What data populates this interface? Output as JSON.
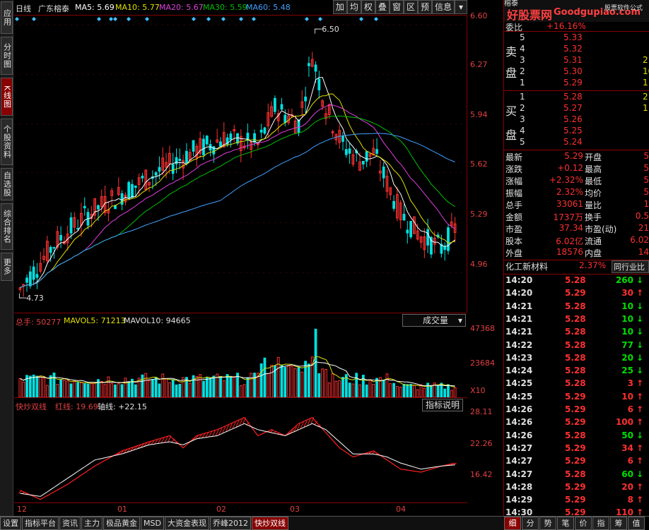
{
  "left_nav": [
    "应用",
    "分时图",
    "K线图",
    "个股资料",
    "自选股",
    "综合排名",
    "更多"
  ],
  "left_nav_active": "K线图",
  "header": {
    "period": "日线",
    "stock_name": "广东榕泰",
    "ma5": "MA5: 5.69",
    "ma10": "MA10: 5.77",
    "ma20": "MA20: 5.67",
    "ma30": "MA30: 5.59",
    "ma60": "MA60: 5.48"
  },
  "toolbar": [
    "加",
    "均",
    "权",
    "叠",
    "窗",
    "区",
    "预",
    "信息"
  ],
  "price_axis": [
    "6.60",
    "6.27",
    "5.94",
    "5.62",
    "5.29",
    "4.96"
  ],
  "annotations": {
    "high": "6.50",
    "low": "4.73"
  },
  "volume": {
    "label": "总手: 50277",
    "mavol5": "MAVOL5: 71213",
    "mavol10": "MAVOL10: 94665",
    "dropdown": "成交量",
    "ticks": [
      "47368",
      "23684"
    ],
    "unit": "X10"
  },
  "indicator": {
    "name": "快炒双线",
    "red_line": "红线: 19.69",
    "axis_line": "轴线: +22.15",
    "button": "指标说明",
    "ticks": [
      "28.11",
      "22.26",
      "16.42"
    ]
  },
  "x_axis": [
    "12",
    "01",
    "02",
    "03",
    "04"
  ],
  "bottom_tabs": [
    "设置",
    "指标平台",
    "资讯",
    "主力",
    "极品黄金",
    "MSD",
    "大资金表现",
    "乔峰2012",
    "快炒双线"
  ],
  "bottom_tabs_active": "快炒双线",
  "watermark": {
    "site": "好股票网",
    "url": "Goodgupiao.com",
    "tagline": "股票软件公式"
  },
  "quote": {
    "title_partial": "榕泰",
    "weibi_label": "委比",
    "weibi_value": "+16.16%",
    "sell_label": [
      "卖",
      "盘"
    ],
    "buy_label": [
      "买",
      "盘"
    ],
    "sell": [
      {
        "level": "5",
        "price": "5.33",
        "vol": ""
      },
      {
        "level": "4",
        "price": "5.32",
        "vol": ""
      },
      {
        "level": "3",
        "price": "5.31",
        "vol": "2"
      },
      {
        "level": "2",
        "price": "5.30",
        "vol": "10"
      },
      {
        "level": "1",
        "price": "5.29",
        "vol": "1"
      }
    ],
    "buy": [
      {
        "level": "1",
        "price": "5.28",
        "vol": "21"
      },
      {
        "level": "2",
        "price": "5.27",
        "vol": "1"
      },
      {
        "level": "3",
        "price": "5.26",
        "vol": ""
      },
      {
        "level": "4",
        "price": "5.25",
        "vol": ""
      },
      {
        "level": "5",
        "price": "5.24",
        "vol": ""
      }
    ],
    "stats": [
      {
        "l1": "最新",
        "v1": "5.29",
        "l2": "开盘",
        "v2": "5"
      },
      {
        "l1": "涨跌",
        "v1": "+0.12",
        "l2": "最高",
        "v2": "5"
      },
      {
        "l1": "涨幅",
        "v1": "+2.32%",
        "l2": "最低",
        "v2": "5"
      },
      {
        "l1": "振幅",
        "v1": "2.32%",
        "l2": "均价",
        "v2": "5"
      },
      {
        "l1": "总手",
        "v1": "33061",
        "l2": "量比",
        "v2": "1"
      },
      {
        "l1": "金额",
        "v1": "1737万",
        "l2": "换手",
        "v2": "0.5"
      },
      {
        "l1": "市盈",
        "v1": "37.34",
        "l2": "市盈(动)",
        "v2": "21"
      },
      {
        "l1": "股本",
        "v1": "6.02亿",
        "l2": "流通",
        "v2": "6.02"
      },
      {
        "l1": "外盘",
        "v1": "18576",
        "l2": "内盘",
        "v2": "14"
      }
    ],
    "sector": "化工新材料",
    "sector_change": "2.37%",
    "sector_button": "同行业比",
    "ticks": [
      {
        "time": "14:20",
        "price": "5.28",
        "vol": "260",
        "dir": "down"
      },
      {
        "time": "14:20",
        "price": "5.29",
        "vol": "30",
        "dir": "up"
      },
      {
        "time": "14:21",
        "price": "5.28",
        "vol": "10",
        "dir": "down"
      },
      {
        "time": "14:21",
        "price": "5.28",
        "vol": "10",
        "dir": "down"
      },
      {
        "time": "14:21",
        "price": "5.28",
        "vol": "10",
        "dir": "down"
      },
      {
        "time": "14:22",
        "price": "5.28",
        "vol": "77",
        "dir": "down"
      },
      {
        "time": "14:23",
        "price": "5.28",
        "vol": "20",
        "dir": "down"
      },
      {
        "time": "14:24",
        "price": "5.28",
        "vol": "25",
        "dir": "down"
      },
      {
        "time": "14:25",
        "price": "5.28",
        "vol": "3",
        "dir": "up"
      },
      {
        "time": "14:25",
        "price": "5.29",
        "vol": "10",
        "dir": "up"
      },
      {
        "time": "14:26",
        "price": "5.29",
        "vol": "6",
        "dir": "up"
      },
      {
        "time": "14:26",
        "price": "5.29",
        "vol": "100",
        "dir": "up"
      },
      {
        "time": "14:26",
        "price": "5.28",
        "vol": "50",
        "dir": "down"
      },
      {
        "time": "14:27",
        "price": "5.29",
        "vol": "34",
        "dir": "up"
      },
      {
        "time": "14:27",
        "price": "5.29",
        "vol": "6",
        "dir": "up"
      },
      {
        "time": "14:27",
        "price": "5.28",
        "vol": "60",
        "dir": "down"
      },
      {
        "time": "14:28",
        "price": "5.29",
        "vol": "20",
        "dir": "up"
      },
      {
        "time": "14:29",
        "price": "5.29",
        "vol": "8",
        "dir": "up"
      },
      {
        "time": "14:30",
        "price": "5.29",
        "vol": "110",
        "dir": "up"
      }
    ],
    "bottom_tabs": [
      "细",
      "分",
      "势",
      "笔",
      "价",
      "指",
      "筹",
      "值"
    ]
  },
  "colors": {
    "up": "#ff3030",
    "down": "#00e0e0",
    "ma5": "#ffffff",
    "ma10": "#e0e000",
    "ma20": "#e040e0",
    "ma30": "#00c000",
    "ma60": "#40a0ff",
    "frame": "#880000"
  }
}
